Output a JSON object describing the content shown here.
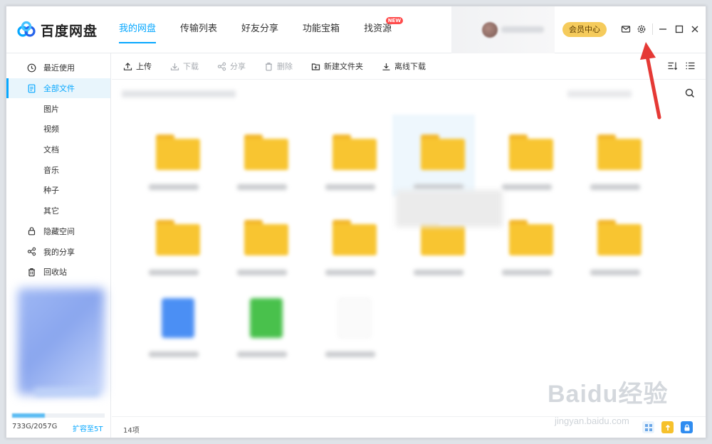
{
  "app": {
    "name": "百度网盘"
  },
  "nav": [
    {
      "label": "我的网盘"
    },
    {
      "label": "传输列表"
    },
    {
      "label": "好友分享"
    },
    {
      "label": "功能宝箱"
    },
    {
      "label": "找资源",
      "badge": "NEW"
    }
  ],
  "header": {
    "vip_label": "会员中心"
  },
  "sidebar": {
    "items": [
      {
        "label": "最近使用",
        "icon": "clock-icon"
      },
      {
        "label": "全部文件",
        "icon": "file-icon"
      },
      {
        "label": "图片"
      },
      {
        "label": "视频"
      },
      {
        "label": "文档"
      },
      {
        "label": "音乐"
      },
      {
        "label": "种子"
      },
      {
        "label": "其它"
      },
      {
        "label": "隐藏空间",
        "icon": "lock-icon"
      },
      {
        "label": "我的分享",
        "icon": "share-icon"
      },
      {
        "label": "回收站",
        "icon": "trash-icon"
      }
    ],
    "storage": {
      "text": "733G/2057G",
      "used_fraction": 0.356,
      "expand_label": "扩容至5T"
    }
  },
  "toolbar": {
    "upload": "上传",
    "download": "下载",
    "share": "分享",
    "delete": "删除",
    "new_folder": "新建文件夹",
    "offline_download": "离线下载"
  },
  "status": {
    "count": "14项"
  },
  "watermark": {
    "big": "Baidu经验",
    "small": "jingyan.baidu.com"
  },
  "colors": {
    "accent": "#06a7ff",
    "vip": "#f5cb5c",
    "folder": "#f8c531",
    "arrow": "#e53935"
  }
}
